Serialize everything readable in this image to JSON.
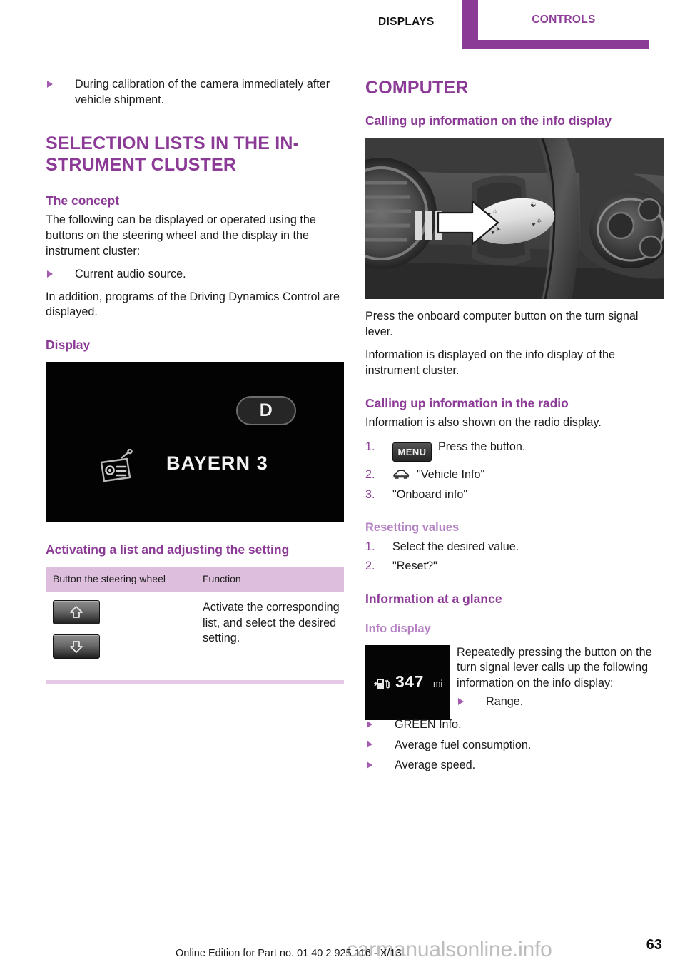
{
  "header": {
    "tab_displays": "DISPLAYS",
    "tab_controls": "CONTROLS",
    "accent_color": "#8b3a96",
    "lavender_color": "#ddbfdd"
  },
  "left_column": {
    "top_bullets": [
      "During calibration of the camera immedi­ately after vehicle shipment."
    ],
    "section_title": "SELECTION LISTS IN THE IN-STRUMENT CLUSTER",
    "concept": {
      "heading": "The concept",
      "paragraph": "The following can be displayed or operated us­ing the buttons on the steering wheel and the display in the instrument cluster:",
      "bullets": [
        "Current audio source."
      ],
      "paragraph2": "In addition, programs of the Driving Dynamics Control are displayed."
    },
    "display": {
      "heading": "Display",
      "image": {
        "gear_badge": "D",
        "radio_icon": "radio-icon",
        "station_name": "BAYERN 3"
      }
    },
    "activating": {
      "heading": "Activating a list and adjusting the setting",
      "table": {
        "columns": [
          "Button the steering wheel",
          "Function"
        ],
        "rows": [
          {
            "buttons": [
              "arrow-up-button",
              "arrow-down-button"
            ],
            "function": "Activate the corre­sponding list, and se­lect the desired set­ting."
          }
        ]
      }
    }
  },
  "right_column": {
    "section_title": "COMPUTER",
    "info_display_section": {
      "heading": "Calling up information on the info display",
      "photo_caption": "turn-signal-lever-photo",
      "paragraph1": "Press the onboard computer button on the turn signal lever.",
      "paragraph2": "Information is displayed on the info display of the instrument cluster."
    },
    "radio_section": {
      "heading": "Calling up information in the radio",
      "paragraph": "Information is also shown on the radio display.",
      "steps": [
        {
          "num": "1.",
          "icon": "menu-button-icon",
          "icon_label": "MENU",
          "text": "Press the button."
        },
        {
          "num": "2.",
          "icon": "car-icon",
          "icon_label": "",
          "text": "\"Vehicle Info\""
        },
        {
          "num": "3.",
          "icon": "",
          "icon_label": "",
          "text": "\"Onboard info\""
        }
      ]
    },
    "resetting": {
      "heading": "Resetting values",
      "steps": [
        {
          "num": "1.",
          "text": "Select the desired value."
        },
        {
          "num": "2.",
          "text": "\"Reset?\""
        }
      ]
    },
    "glance": {
      "heading": "Information at a glance",
      "subheading": "Info display",
      "info_display_image": {
        "fuel_icon": "fuel-pump-icon",
        "range_value": "347",
        "range_unit": "mi"
      },
      "paragraph": "Repeatedly pressing the button on the turn signal lever calls up the following information on the info display:",
      "inline_bullets": [
        "Range."
      ],
      "bullets": [
        "GREEN Info.",
        "Average fuel consumption.",
        "Average speed."
      ]
    }
  },
  "footer": {
    "note": "Online Edition for Part no. 01 40 2 925 116 - X/13",
    "page_number": "63",
    "watermark": "carmanualsonline.info"
  }
}
